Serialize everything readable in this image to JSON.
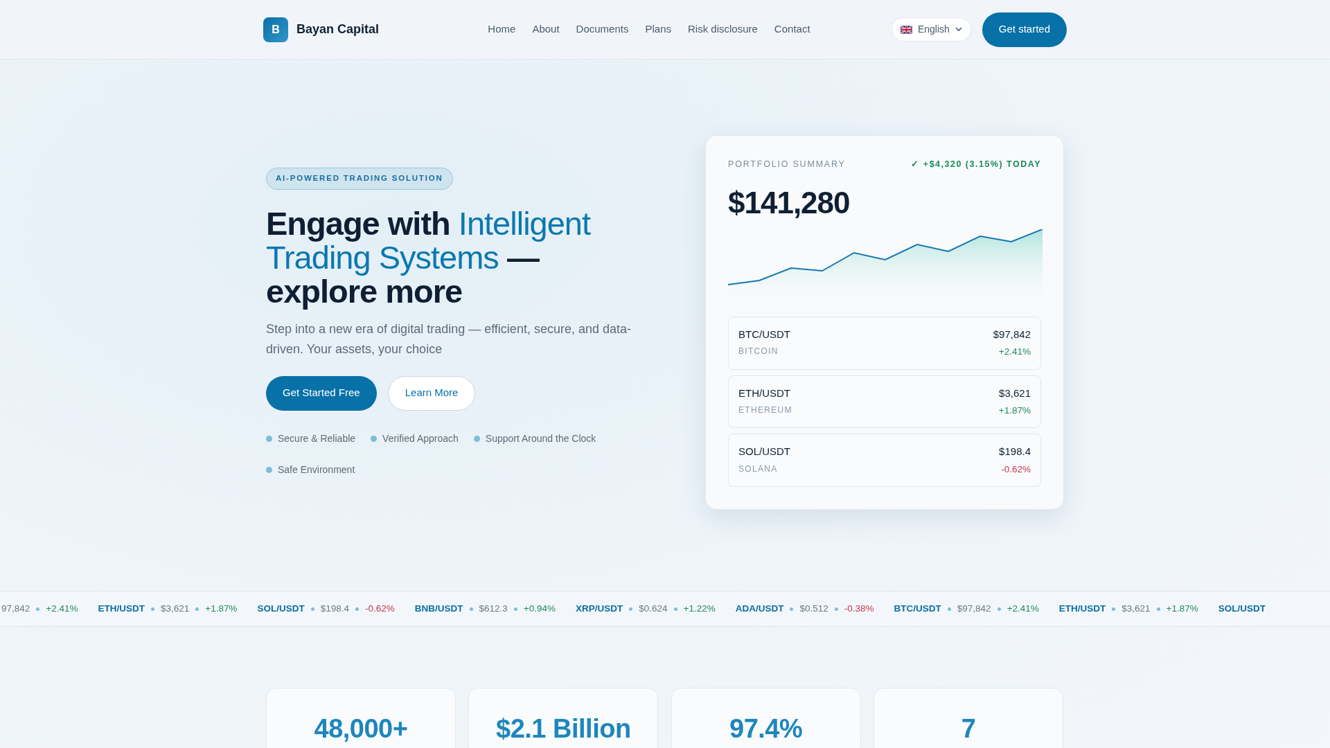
{
  "brand": {
    "logo_letter": "B",
    "name": "Bayan Capital"
  },
  "nav": [
    {
      "label": "Home"
    },
    {
      "label": "About"
    },
    {
      "label": "Documents"
    },
    {
      "label": "Plans"
    },
    {
      "label": "Risk disclosure"
    },
    {
      "label": "Contact"
    }
  ],
  "language": {
    "label": "English"
  },
  "cta": "Get started",
  "hero": {
    "badge": "AI-POWERED TRADING SOLUTION",
    "title": [
      {
        "text": "Engage with ",
        "highlight": false
      },
      {
        "text": "Intelligent Trading Systems",
        "highlight": true
      },
      {
        "text": " — explore more",
        "highlight": false
      }
    ],
    "subtitle": "Step into a new era of digital trading — efficient, secure, and data-driven. Your assets, your choice",
    "buttons": [
      {
        "label": "Get Started Free",
        "kind": "primary"
      },
      {
        "label": "Learn More",
        "kind": "outline"
      }
    ],
    "features": [
      "Secure & Reliable",
      "Verified Approach",
      "Support Around the Clock",
      "Safe Environment"
    ]
  },
  "portfolio": {
    "label": "PORTFOLIO SUMMARY",
    "change": "✓ +$4,320 (3.15%) TODAY",
    "total": "$141,280",
    "assets": [
      {
        "pair": "BTC/USDT",
        "name": "BITCOIN",
        "price": "$97,842",
        "change": "+2.41%",
        "kind": "gain"
      },
      {
        "pair": "ETH/USDT",
        "name": "ETHEREUM",
        "price": "$3,621",
        "change": "+1.87%",
        "kind": "gain"
      },
      {
        "pair": "SOL/USDT",
        "name": "SOLANA",
        "price": "$198.4",
        "change": "-0.62%",
        "kind": "loss"
      }
    ]
  },
  "ticker": [
    {
      "price": "97,842",
      "change": "+2.41%",
      "kind": "gain"
    },
    {
      "pair": "ETH/USDT",
      "price": "$3,621",
      "change": "+1.87%",
      "kind": "gain"
    },
    {
      "pair": "SOL/USDT",
      "price": "$198.4",
      "change": "-0.62%",
      "kind": "loss"
    },
    {
      "pair": "BNB/USDT",
      "price": "$612.3",
      "change": "+0.94%",
      "kind": "gain"
    },
    {
      "pair": "XRP/USDT",
      "price": "$0.624",
      "change": "+1.22%",
      "kind": "gain"
    },
    {
      "pair": "ADA/USDT",
      "price": "$0.512",
      "change": "-0.38%",
      "kind": "loss"
    },
    {
      "pair": "BTC/USDT",
      "price": "$97,842",
      "change": "+2.41%",
      "kind": "gain"
    },
    {
      "pair": "ETH/USDT",
      "price": "$3,621",
      "change": "+1.87%",
      "kind": "gain"
    },
    {
      "pair": "SOL/USDT"
    }
  ],
  "stats": [
    "48,000+",
    "$2.1 Billion",
    "97.4%",
    "7"
  ]
}
